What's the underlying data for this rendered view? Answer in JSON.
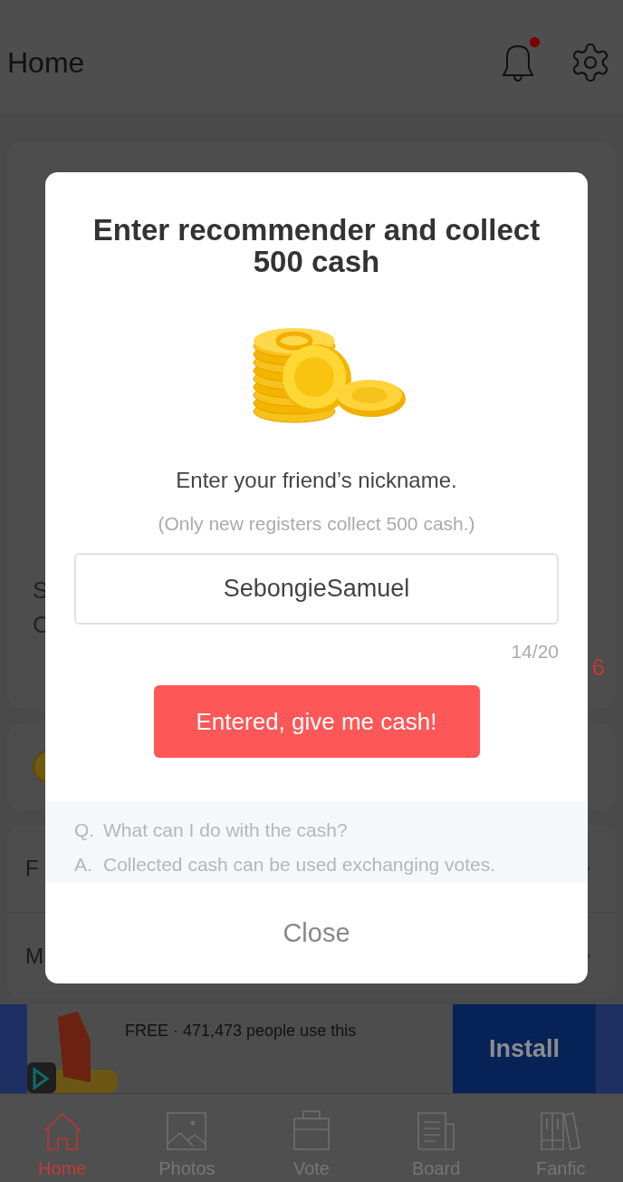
{
  "header": {
    "title": "Home",
    "notification_dot": true
  },
  "background_fragments": {
    "card_1": [
      "S",
      "C"
    ],
    "card_1_value": "6",
    "rows": [
      "F",
      "M"
    ]
  },
  "dialog": {
    "title": "Enter recommender and collect 500 cash",
    "prompt": "Enter your friend’s nickname.",
    "note": "(Only new registers collect 500 cash.)",
    "input": {
      "value": "SebongieSamuel"
    },
    "counter": "14/20",
    "submit": "Entered, give me cash!",
    "faq": [
      {
        "mark": "Q.",
        "text": "What can I do with the cash?"
      },
      {
        "mark": "A.",
        "text": "Collected cash can be used exchanging votes."
      }
    ],
    "close": "Close"
  },
  "ad": {
    "subtitle": "FREE · 471,473 people use this",
    "button": "Install"
  },
  "tabs": [
    {
      "label": "Home",
      "kind": "home",
      "selected": true
    },
    {
      "label": "Photos",
      "kind": "photos",
      "selected": false
    },
    {
      "label": "Vote",
      "kind": "vote",
      "selected": false
    },
    {
      "label": "Board",
      "kind": "board",
      "selected": false
    },
    {
      "label": "Fanfic",
      "kind": "fanfic",
      "selected": false
    }
  ]
}
